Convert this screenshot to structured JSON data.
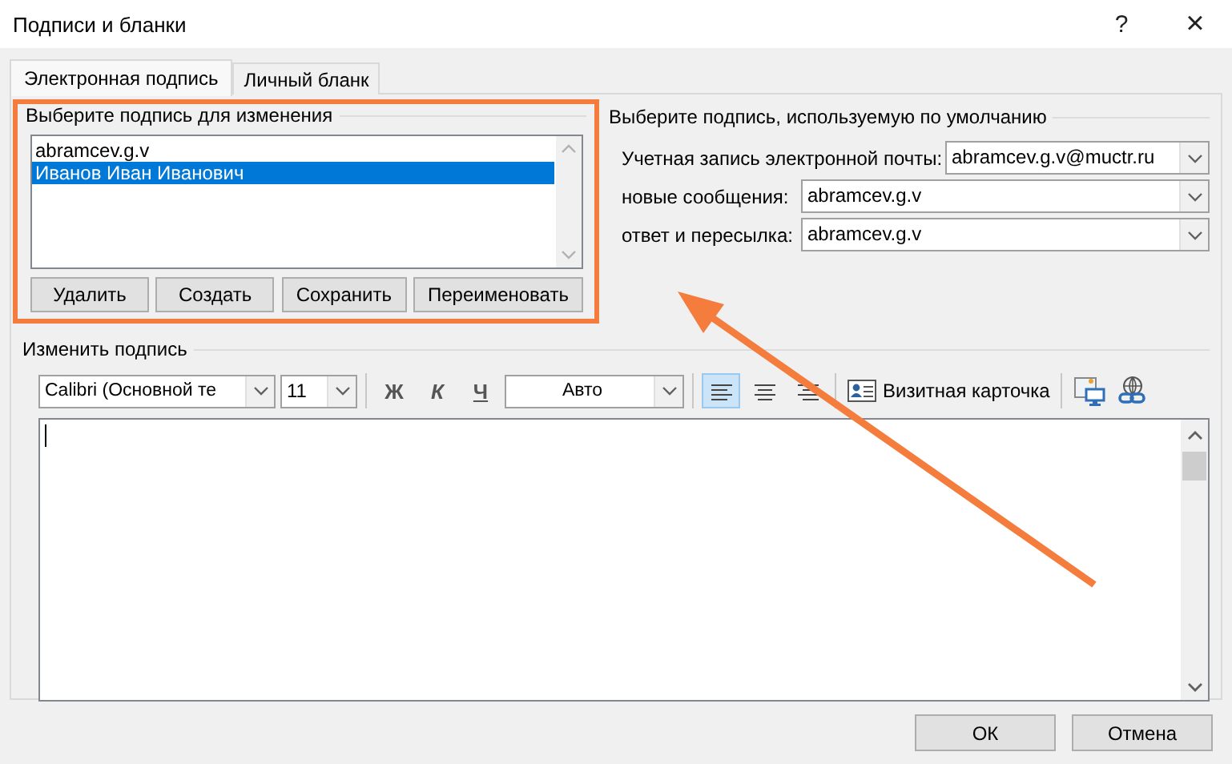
{
  "window": {
    "title": "Подписи и бланки",
    "help": "?",
    "close": "×"
  },
  "tabs": [
    {
      "label": "Электронная подпись",
      "selected": true
    },
    {
      "label": "Личный бланк",
      "selected": false
    }
  ],
  "select_signature": {
    "title": "Выберите подпись для изменения",
    "highlighted": true,
    "items": [
      {
        "label": "abramcev.g.v",
        "selected": false
      },
      {
        "label": "Иванов Иван Иванович",
        "selected": true
      }
    ],
    "buttons": [
      "Удалить",
      "Создать",
      "Сохранить",
      "Переименовать"
    ]
  },
  "default_signature": {
    "title": "Выберите подпись, используемую по умолчанию",
    "fields": [
      {
        "label": "Учетная запись электронной почты:",
        "value": "abramcev.g.v@muctr.ru"
      },
      {
        "label": "новые сообщения:",
        "value": "abramcev.g.v"
      },
      {
        "label": "ответ и пересылка:",
        "value": "abramcev.g.v"
      }
    ]
  },
  "edit_signature": {
    "title": "Изменить подпись",
    "font": "Calibri (Основной те",
    "size": "11",
    "bold": "Ж",
    "italic": "К",
    "underline": "Ч",
    "font_color_text": "Авто",
    "align": [
      {
        "kind": "left",
        "selected": true
      },
      {
        "kind": "center",
        "selected": false
      },
      {
        "kind": "right",
        "selected": false
      }
    ],
    "business_card": "Визитная карточка"
  },
  "footer": {
    "buttons": [
      "ОК",
      "Отмена"
    ]
  }
}
